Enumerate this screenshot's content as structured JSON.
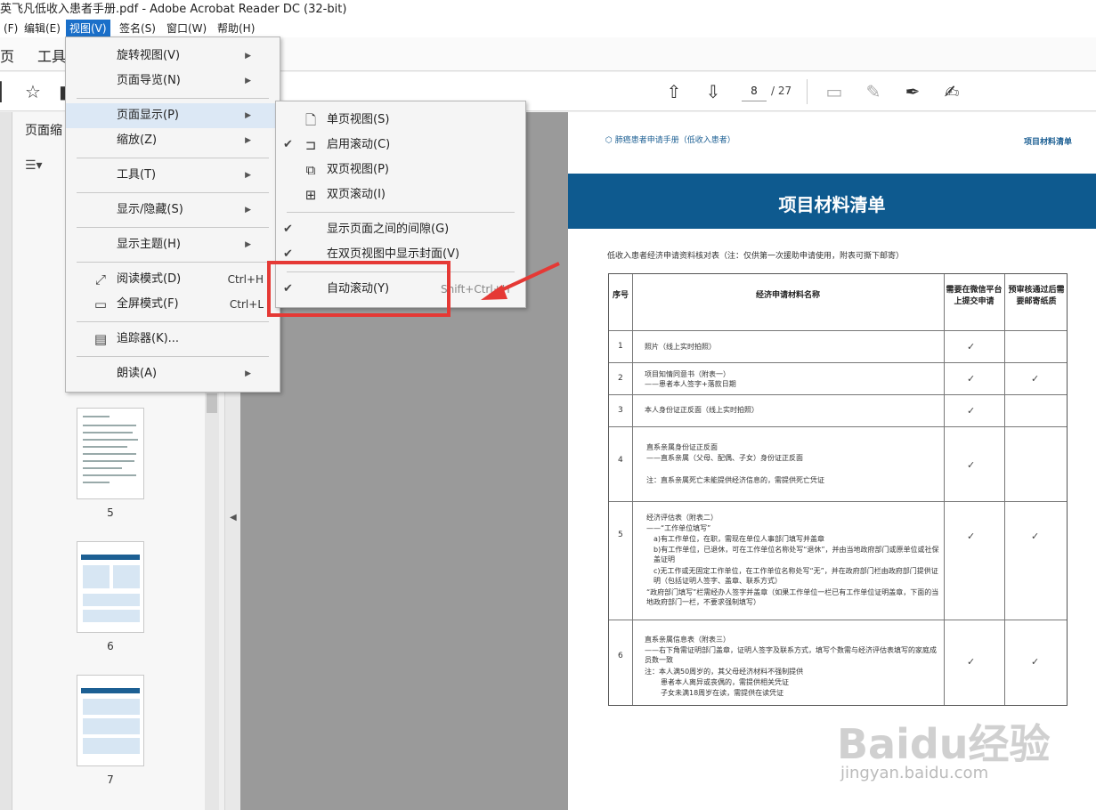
{
  "window": {
    "title": "英飞凡低收入患者手册.pdf - Adobe Acrobat Reader DC (32-bit)"
  },
  "menubar": {
    "items": [
      "(F)",
      "编辑(E)",
      "视图(V)",
      "签名(S)",
      "窗口(W)",
      "帮助(H)"
    ]
  },
  "tabs": {
    "home": "页",
    "tools": "工具"
  },
  "toolbar": {
    "current_page": "8",
    "total_pages": "/ 27"
  },
  "left_panel": {
    "title": "页面缩"
  },
  "thumbnails": [
    {
      "label": "5"
    },
    {
      "label": "6"
    },
    {
      "label": "7"
    }
  ],
  "view_menu": {
    "items": [
      {
        "label": "旋转视图(V)"
      },
      {
        "label": "页面导览(N)"
      },
      {
        "label": "页面显示(P)"
      },
      {
        "label": "缩放(Z)"
      },
      {
        "label": "工具(T)"
      },
      {
        "label": "显示/隐藏(S)"
      },
      {
        "label": "显示主题(H)"
      },
      {
        "label": "阅读模式(D)",
        "shortcut": "Ctrl+H"
      },
      {
        "label": "全屏模式(F)",
        "shortcut": "Ctrl+L"
      },
      {
        "label": "追踪器(K)..."
      },
      {
        "label": "朗读(A)"
      }
    ]
  },
  "page_display_submenu": {
    "items": [
      {
        "label": "单页视图(S)"
      },
      {
        "label": "启用滚动(C)"
      },
      {
        "label": "双页视图(P)"
      },
      {
        "label": "双页滚动(I)"
      },
      {
        "label": "显示页面之间的间隙(G)"
      },
      {
        "label": "在双页视图中显示封面(V)"
      },
      {
        "label": "自动滚动(Y)",
        "shortcut": "Shift+Ctrl+H"
      }
    ]
  },
  "document": {
    "header_left": "肺癌患者申请手册（低收入患者）",
    "header_right": "项目材料清单",
    "title": "项目材料清单",
    "subtitle": "低收入患者经济申请资料核对表（注：仅供第一次援助申请使用，附表可撕下邮寄）",
    "table_headers": [
      "序号",
      "经济申请材料名称",
      "需要在微信平台上提交申请",
      "预审核通过后需要邮寄纸质"
    ],
    "rows": [
      {
        "no": "1",
        "lines": [
          "照片（线上实时拍照）"
        ]
      },
      {
        "no": "2",
        "lines": [
          "项目知情同意书（附表一）",
          "——患者本人签字+落款日期"
        ]
      },
      {
        "no": "3",
        "lines": [
          "本人身份证正反面（线上实时拍照）"
        ]
      },
      {
        "no": "4",
        "lines": [
          "直系亲属身份证正反面",
          "——直系亲属（父母、配偶、子女）身份证正反面",
          "",
          "注：直系亲属死亡未能提供经济信息的，需提供死亡凭证"
        ]
      },
      {
        "no": "5",
        "lines": [
          "经济评估表（附表二）",
          "——“工作单位填写”",
          "a)有工作单位，在职，需现在单位人事部门填写并盖章",
          "b)有工作单位，已退休，可在工作单位名称处写“退休”，并由当地政府部门或原单位或社保盖证明",
          "c)无工作或无固定工作单位，在工作单位名称处写“无”，并在政府部门栏由政府部门提供证明（包括证明人签字、盖章、联系方式）",
          "“政府部门填写”栏需经办人签字并盖章（如果工作单位一栏已有工作单位证明盖章，下面的当地政府部门一栏，不要求强制填写）"
        ]
      },
      {
        "no": "6",
        "lines": [
          "直系亲属信息表（附表三）",
          "——右下角需证明部门盖章，证明人签字及联系方式，填写个数需与经济评估表填写的家庭成员数一致",
          "注：本人满50周岁的，其父母经济材料不强制提供",
          "患者本人离异或丧偶的，需提供相关凭证",
          "子女未满18周岁在读，需提供在读凭证"
        ]
      }
    ],
    "check": "✓"
  },
  "watermark": {
    "brand": "Baidu经验",
    "url": "jingyan.baidu.com"
  },
  "colors": {
    "menu_highlight": "#dce8f5",
    "active_menu": "#1a6fc9",
    "banner": "#0e5a8f",
    "annotation_red": "#e53935"
  }
}
